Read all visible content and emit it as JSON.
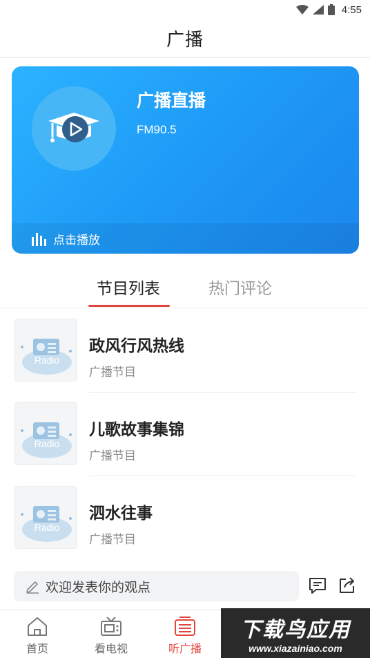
{
  "status_bar": {
    "time": "4:55"
  },
  "header": {
    "title": "广播"
  },
  "banner": {
    "title": "广播直播",
    "frequency": "FM90.5",
    "play_label": "点击播放",
    "icon": "graduation-cap-play-icon"
  },
  "tabs": [
    {
      "label": "节目列表",
      "active": true
    },
    {
      "label": "热门评论",
      "active": false
    }
  ],
  "programs": [
    {
      "title": "政风行风热线",
      "category": "广播节目",
      "thumb_text": "Radio"
    },
    {
      "title": "儿歌故事集锦",
      "category": "广播节目",
      "thumb_text": "Radio"
    },
    {
      "title": "泗水往事",
      "category": "广播节目",
      "thumb_text": "Radio"
    }
  ],
  "comment": {
    "placeholder": "欢迎发表你的观点"
  },
  "bottom_nav": [
    {
      "label": "首页",
      "icon": "home-icon",
      "active": false
    },
    {
      "label": "看电视",
      "icon": "tv-icon",
      "active": false
    },
    {
      "label": "听广播",
      "icon": "radio-icon",
      "active": true
    }
  ],
  "watermark": {
    "main": "下载鸟应用",
    "sub": "www.xiazainiao.com"
  },
  "colors": {
    "accent": "#e0463d",
    "banner_blue": "#1e9af7"
  }
}
